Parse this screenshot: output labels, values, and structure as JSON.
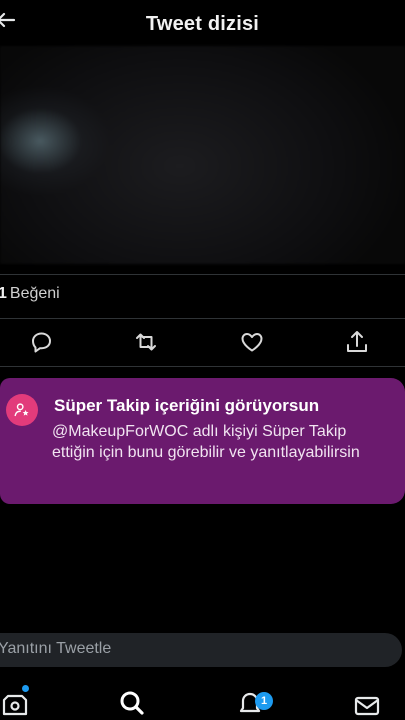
{
  "header": {
    "title": "Tweet dizisi",
    "back_icon": "arrow-left-icon"
  },
  "stats": {
    "likes_count": "1",
    "likes_label": "Beğeni"
  },
  "actions": [
    "reply-icon",
    "retweet-icon",
    "like-icon",
    "share-icon"
  ],
  "banner": {
    "title": "Süper Takip içeriğini görüyorsun",
    "text": "@MakeupForWOC adlı kişiyi Süper Takip ettiğin için bunu görebilir ve yanıtlayabilirsin",
    "icon": "super-follow-icon",
    "background": "#6b1a6e",
    "icon_color": "#e23b7b"
  },
  "reply": {
    "placeholder": "Yanıtını Tweetle"
  },
  "tabbar": {
    "items": [
      "spaces-icon",
      "search-icon",
      "notifications-icon",
      "messages-icon"
    ],
    "notification_badge": "1",
    "accent": "#1d9bf0"
  }
}
